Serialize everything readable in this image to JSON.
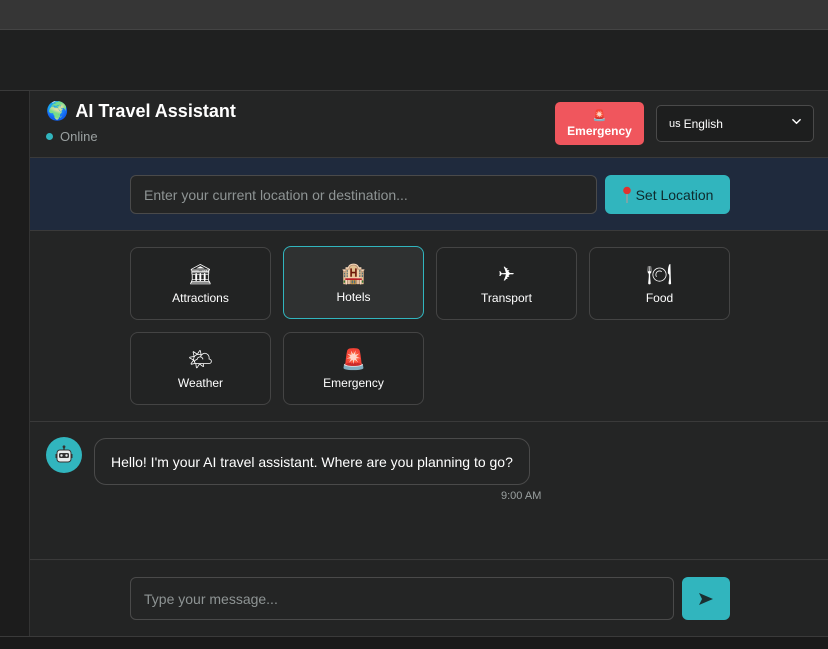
{
  "header": {
    "title": "AI Travel Assistant",
    "status": "Online",
    "emergency_label": "Emergency",
    "language": {
      "flag_text": "us",
      "selected": "English"
    }
  },
  "location": {
    "placeholder": "Enter your current location or destination...",
    "set_label": "Set Location"
  },
  "categories": [
    {
      "label": "Attractions",
      "icon": "classical-building-icon",
      "glyph": "🏛"
    },
    {
      "label": "Hotels",
      "icon": "hotel-icon",
      "glyph": "🏨",
      "active": true
    },
    {
      "label": "Transport",
      "icon": "airplane-icon",
      "glyph": "✈"
    },
    {
      "label": "Food",
      "icon": "plate-cutlery-icon",
      "glyph": "🍽"
    },
    {
      "label": "Weather",
      "icon": "sun-cloud-icon",
      "glyph": "🌤"
    },
    {
      "label": "Emergency",
      "icon": "siren-icon",
      "glyph": "🚨"
    }
  ],
  "chat": {
    "messages": [
      {
        "sender": "bot",
        "text": "Hello! I'm your AI travel assistant. Where are you planning to go?",
        "time": "9:00 AM"
      }
    ]
  },
  "composer": {
    "placeholder": "Type your message..."
  },
  "colors": {
    "accent": "#31b5be",
    "emergency": "#f0565d",
    "location_bar": "#1f2a3d"
  }
}
